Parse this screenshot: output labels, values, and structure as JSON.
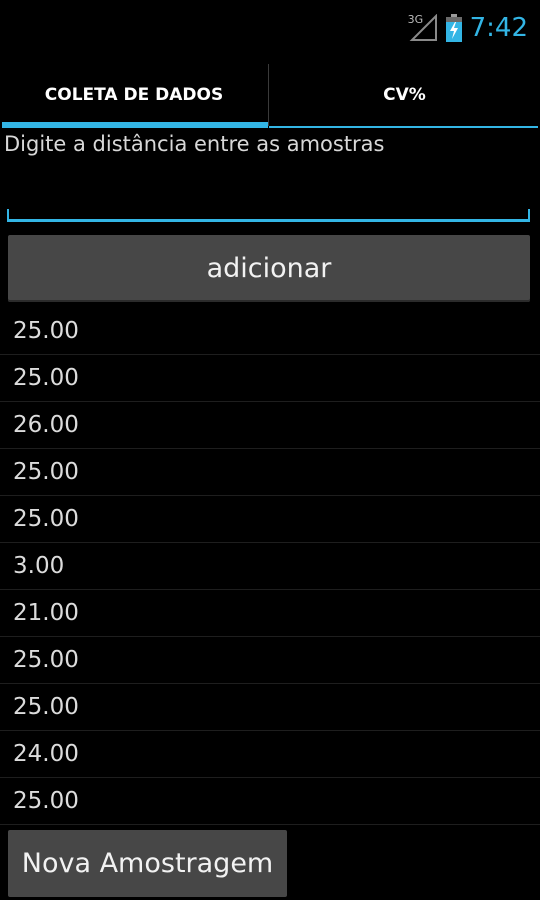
{
  "status_bar": {
    "network": "3G",
    "time": "7:42",
    "icons": [
      "signal-icon",
      "battery-charging-icon"
    ]
  },
  "tabs": [
    {
      "label": "COLETA DE DADOS",
      "selected": true
    },
    {
      "label": "CV%",
      "selected": false
    }
  ],
  "form": {
    "prompt": "Digite a distância entre as amostras",
    "input_value": "",
    "add_label": "adicionar"
  },
  "samples": [
    "25.00",
    "25.00",
    "26.00",
    "25.00",
    "25.00",
    "3.00",
    "21.00",
    "25.00",
    "25.00",
    "24.00",
    "25.00"
  ],
  "footer": {
    "new_label": "Nova Amostragem"
  },
  "colors": {
    "accent": "#33b5e5",
    "background": "#000000",
    "button": "#474747"
  }
}
